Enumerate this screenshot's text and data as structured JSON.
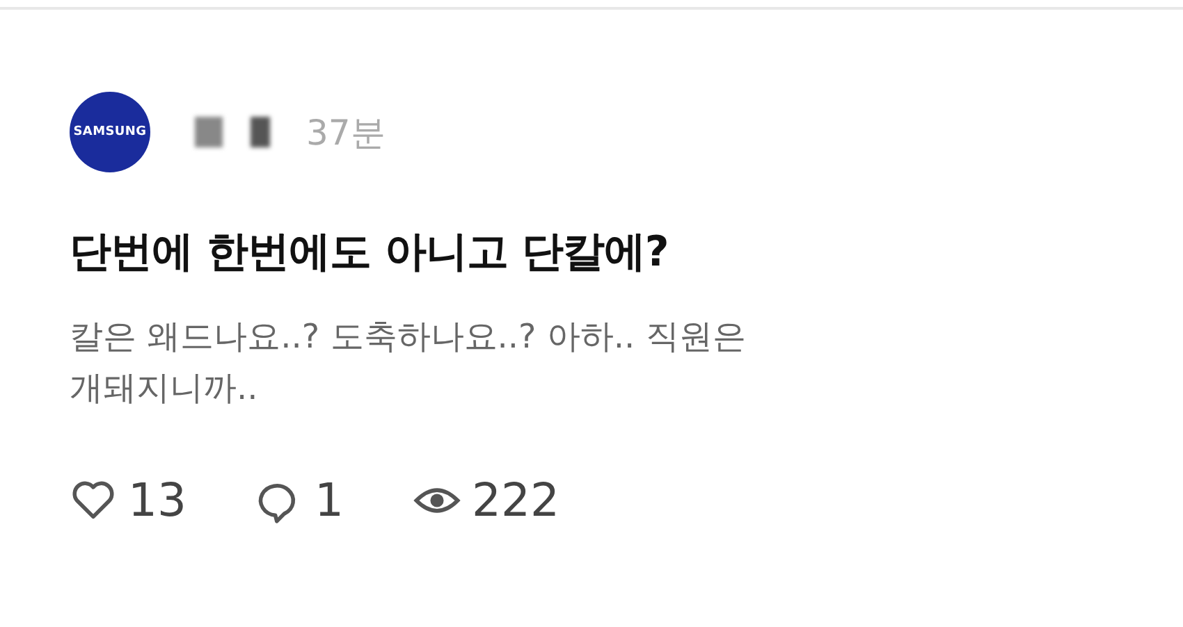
{
  "post": {
    "author": {
      "avatar_label": "SAMSUNG",
      "name_redacted": true
    },
    "time": "37분",
    "title": "단번에 한번에도 아니고 단칼에?",
    "body": "칼은 왜드나요..? 도축하나요..? 아하.. 직원은 개돼지니까..",
    "stats": [
      {
        "kind": "likes",
        "count": "13"
      },
      {
        "kind": "comments",
        "count": "1"
      },
      {
        "kind": "views",
        "count": "222"
      }
    ]
  }
}
